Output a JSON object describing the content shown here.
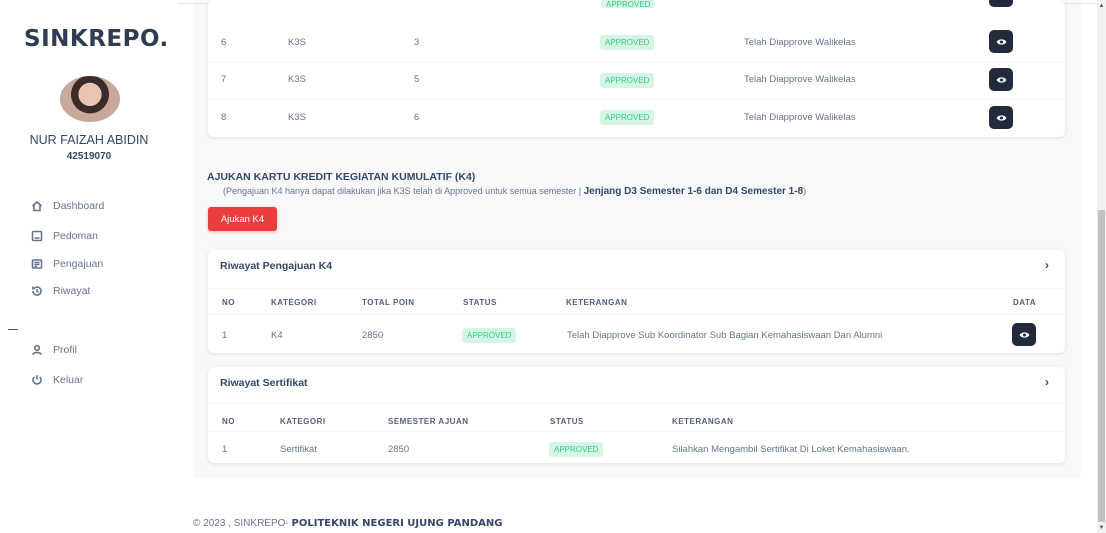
{
  "sidebar": {
    "brand": "SINKREPO.",
    "user_name": "NUR FAIZAH ABIDIN",
    "user_nim": "42519070",
    "items": [
      {
        "label": "Dashboard",
        "icon": "home-icon"
      },
      {
        "label": "Pedoman",
        "icon": "book-icon"
      },
      {
        "label": "Pengajuan",
        "icon": "form-icon"
      },
      {
        "label": "Riwayat",
        "icon": "history-icon"
      },
      {
        "label": "Profil",
        "icon": "user-icon"
      },
      {
        "label": "Keluar",
        "icon": "power-icon"
      }
    ]
  },
  "k3s_table": {
    "rows": [
      {
        "no": "6",
        "kategori": "K3S",
        "semester": "3",
        "status": "APPROVED",
        "keterangan": "Telah Diapprove Walikelas"
      },
      {
        "no": "7",
        "kategori": "K3S",
        "semester": "5",
        "status": "APPROVED",
        "keterangan": "Telah Diapprove Walikelas"
      },
      {
        "no": "8",
        "kategori": "K3S",
        "semester": "6",
        "status": "APPROVED",
        "keterangan": "Telah Diapprove Walikelas"
      }
    ],
    "partial_top_status": "APPROVED"
  },
  "k4": {
    "title": "AJUKAN KARTU KREDIT KEGIATAN KUMULATIF (K4)",
    "note_prefix": "(Pengajuan K4 hanya dapat dilakukan jika K3S telah di Approved untuk semua semester | ",
    "note_bold": "Jenjang D3 Semester 1-6 dan D4 Semester 1-8",
    "note_suffix": ")",
    "button": "Ajukan K4"
  },
  "riwayat_k4": {
    "title": "Riwayat Pengajuan K4",
    "headers": [
      "NO",
      "KATEGORI",
      "TOTAL POIN",
      "STATUS",
      "KETERANGAN",
      "DATA"
    ],
    "rows": [
      {
        "no": "1",
        "kategori": "K4",
        "total_poin": "2850",
        "status": "APPROVED",
        "keterangan": "Telah Diapprove Sub Koordinator Sub Bagian Kemahasiswaan Dan Alumni"
      }
    ]
  },
  "riwayat_sertifikat": {
    "title": "Riwayat Sertifikat",
    "headers": [
      "NO",
      "KATEGORI",
      "SEMESTER AJUAN",
      "STATUS",
      "KETERANGAN"
    ],
    "rows": [
      {
        "no": "1",
        "kategori": "Sertifikat",
        "semester_ajuan": "2850",
        "status": "APPROVED",
        "keterangan": "Silahkan Mengambil Sertifikat Di Loket Kemahasiswaan."
      }
    ]
  },
  "footer": {
    "prefix": "© 2023 , SINKREPO- ",
    "org": "POLITEKNIK NEGERI UJUNG PANDANG"
  },
  "colors": {
    "accent_red": "#ea3e3e",
    "approved_green": "#2dce89",
    "dark_button": "#212b3a"
  }
}
